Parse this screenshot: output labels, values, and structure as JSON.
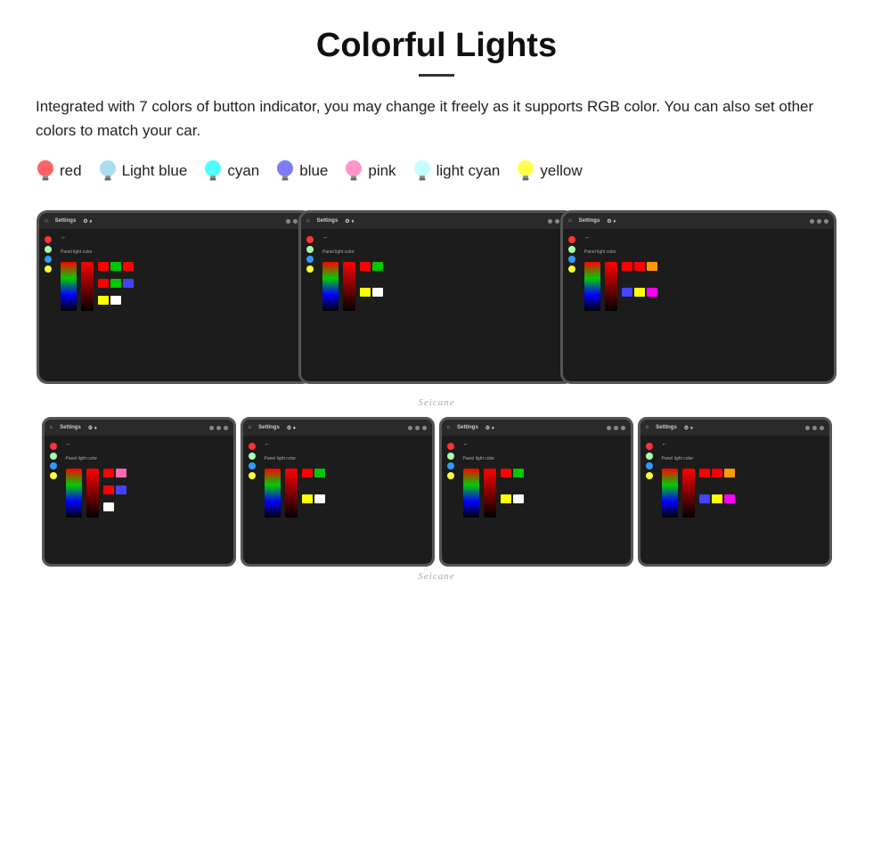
{
  "header": {
    "title": "Colorful Lights",
    "description": "Integrated with 7 colors of button indicator, you may change it freely as it supports RGB color. You can also set other colors to match your car."
  },
  "colorItems": [
    {
      "label": "red",
      "color": "#ff2020",
      "bulbColor": "#ff2020"
    },
    {
      "label": "Light blue",
      "color": "#87ceeb",
      "bulbColor": "#add8e6"
    },
    {
      "label": "cyan",
      "color": "#00ffff",
      "bulbColor": "#00ffff"
    },
    {
      "label": "blue",
      "color": "#4444ff",
      "bulbColor": "#4444ff"
    },
    {
      "label": "pink",
      "color": "#ff69b4",
      "bulbColor": "#ff69b4"
    },
    {
      "label": "light cyan",
      "color": "#aaffff",
      "bulbColor": "#aaffff"
    },
    {
      "label": "yellow",
      "color": "#ffff00",
      "bulbColor": "#ffff00"
    }
  ],
  "watermark": "Seicane",
  "topRow": {
    "screens": [
      {
        "settingsLabel": "Settings",
        "colorSquares": [
          "#ff0000",
          "#00c800",
          "#ff0000",
          "#ff0000",
          "#00c800",
          "#4444ff",
          "#ffff00",
          "#ffffff"
        ]
      },
      {
        "settingsLabel": "Settings",
        "colorSquares": [
          "#ff0000",
          "#00c800",
          "#ffff00",
          "#ffffff"
        ]
      },
      {
        "settingsLabel": "Settings",
        "colorSquares": [
          "#ff0000",
          "#ff0000",
          "#ff9900",
          "#4444ff",
          "#ffff00",
          "#ff00ff"
        ]
      }
    ]
  },
  "bottomRow": {
    "screens": [
      {
        "settingsLabel": "Settings",
        "colorSquares": [
          "#ff0000",
          "#ff69b4",
          "#ff0000",
          "#4444ff",
          "#ffffff"
        ]
      },
      {
        "settingsLabel": "Settings",
        "colorSquares": [
          "#ff0000",
          "#00c800",
          "#ffff00",
          "#ffffff"
        ]
      },
      {
        "settingsLabel": "Settings",
        "colorSquares": [
          "#ff0000",
          "#00c800",
          "#ffff00",
          "#ffffff"
        ]
      },
      {
        "settingsLabel": "Settings",
        "colorSquares": [
          "#ff0000",
          "#ff0000",
          "#ff9900",
          "#4444ff",
          "#ffff00",
          "#ff00ff"
        ]
      }
    ]
  }
}
